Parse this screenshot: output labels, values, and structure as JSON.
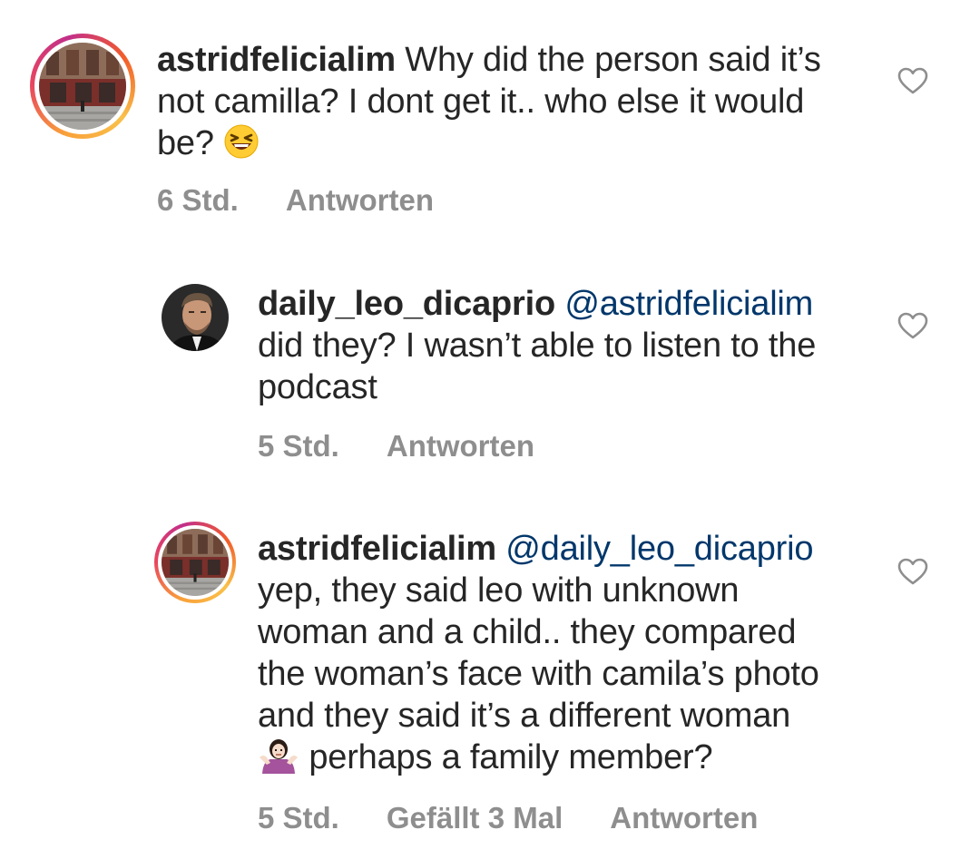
{
  "comments": [
    {
      "username": "astridfelicialim",
      "mention": "",
      "text_line1": " Why did the person said it’s",
      "text_line2": "not camilla? I dont get it.. who else it would",
      "text_line3": "be? ",
      "emoji_icon": "grinning-squinting-face-icon",
      "time": "6 Std.",
      "likes": "",
      "reply_label": "Antworten"
    },
    {
      "username": "daily_leo_dicaprio",
      "mention": "@astridfelicialim",
      "text_line1": "did they? I wasn’t able to listen to the",
      "text_line2": "podcast",
      "time": "5 Std.",
      "likes": "",
      "reply_label": "Antworten"
    },
    {
      "username": "astridfelicialim",
      "mention": "@daily_leo_dicaprio",
      "text_line1": "yep, they said leo with unknown",
      "text_line2": "woman and a child.. they compared",
      "text_line3": "the woman’s face with camila’s photo",
      "text_line4": "and they said it’s a different woman",
      "text_line5": " perhaps a family member?",
      "emoji_icon": "person-shrugging-icon",
      "time": "5 Std.",
      "likes": "Gefällt 3 Mal",
      "reply_label": "Antworten"
    }
  ],
  "colors": {
    "text": "#262626",
    "meta": "#8e8e8e",
    "mention": "#00376b",
    "heart": "#8e8e8e"
  }
}
